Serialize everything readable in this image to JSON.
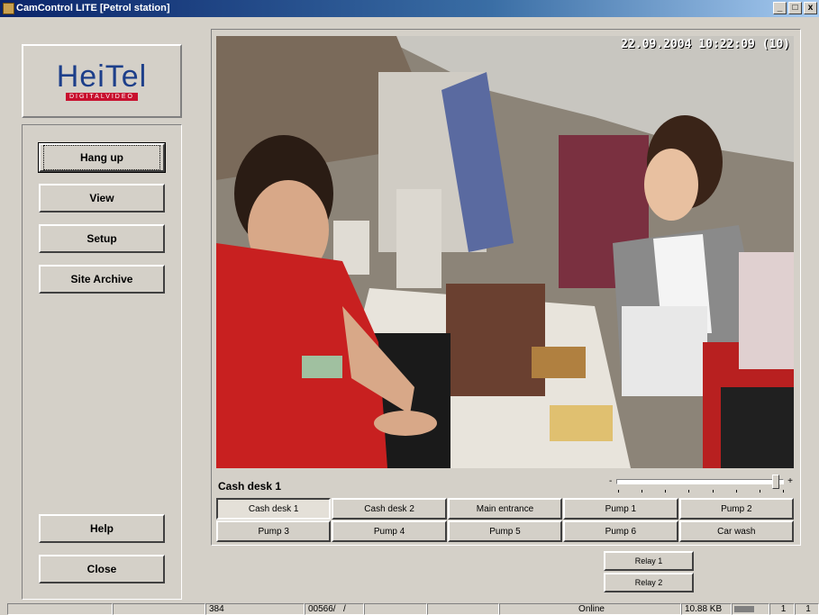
{
  "window": {
    "title": "CamControl LITE   [Petrol station]",
    "minimize": "_",
    "maximize": "□",
    "close": "x"
  },
  "logo": {
    "brand": "HeiTel",
    "tagline": "DIGITALVIDEO"
  },
  "nav": {
    "hang_up": "Hang up",
    "view": "View",
    "setup": "Setup",
    "site_archive": "Site Archive",
    "help": "Help",
    "close": "Close"
  },
  "video": {
    "timestamp": "22.09.2004 10:22:09 (10)",
    "camera_label": "Cash desk 1",
    "slider_min": "-",
    "slider_max": "+",
    "slider_level": 0.97
  },
  "cameras": [
    "Cash desk 1",
    "Cash desk 2",
    "Main entrance",
    "Pump 1",
    "Pump 2",
    "Pump 3",
    "Pump 4",
    "Pump 5",
    "Pump 6",
    "Car wash"
  ],
  "active_camera": "Cash desk 1",
  "relays": {
    "relay1": "Relay 1",
    "relay2": "Relay 2"
  },
  "status": {
    "resolution": "384",
    "frame": "00566/",
    "slash": "/",
    "state": "Online",
    "size": "10.88 KB",
    "n1": "1",
    "n2": "1"
  },
  "colors": {
    "face": "#d4d0c8",
    "title_start": "#0a246a",
    "brand_blue": "#1d3f8a",
    "brand_red": "#c8102e"
  }
}
